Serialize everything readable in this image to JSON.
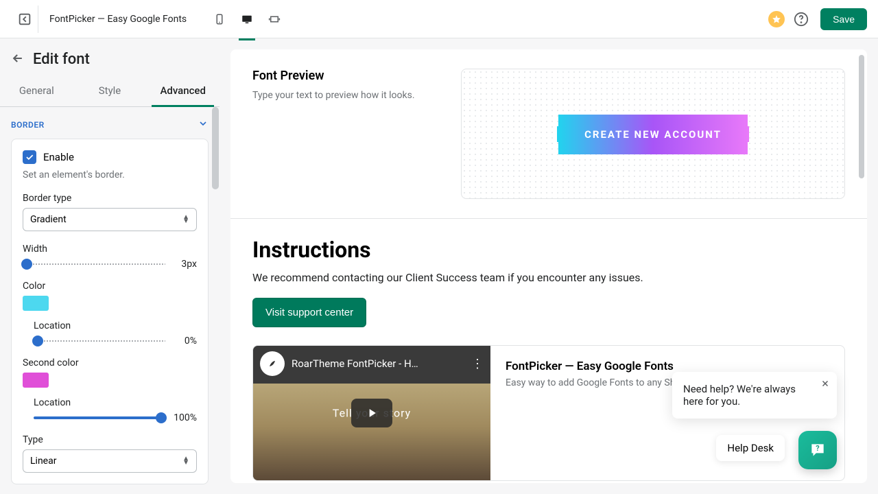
{
  "colors": {
    "cyan": "#4dd8ef",
    "magenta": "#e04fd8",
    "accent": "#008060"
  },
  "topbar": {
    "app_title": "FontPicker — Easy Google Fonts",
    "save_label": "Save"
  },
  "sidebar": {
    "title": "Edit font",
    "tabs": {
      "general": "General",
      "style": "Style",
      "advanced": "Advanced"
    },
    "section_label": "Border",
    "enable_label": "Enable",
    "enable_hint": "Set an element's border.",
    "border_type_label": "Border type",
    "border_type_value": "Gradient",
    "width_label": "Width",
    "width_value": "3px",
    "color_label": "Color",
    "location_label": "Location",
    "color1_location_value": "0%",
    "second_color_label": "Second color",
    "color2_location_value": "100%",
    "type_label": "Type",
    "type_value": "Linear"
  },
  "main": {
    "preview_title": "Font Preview",
    "preview_sub": "Type your text to preview how it looks.",
    "preview_button": "CREATE NEW ACCOUNT",
    "instructions_title": "Instructions",
    "instructions_sub": "We recommend contacting our Client Success team if you encounter any issues.",
    "visit_btn": "Visit support center",
    "video_overlay_title": "RoarTheme FontPicker - H…",
    "video_caption": "Tell your story",
    "video_card_title": "FontPicker — Easy Google Fonts",
    "video_card_sub": "Easy way to add Google Fonts to any Sho"
  },
  "help": {
    "pop": "Need help? We're always here for you.",
    "desk": "Help Desk"
  }
}
